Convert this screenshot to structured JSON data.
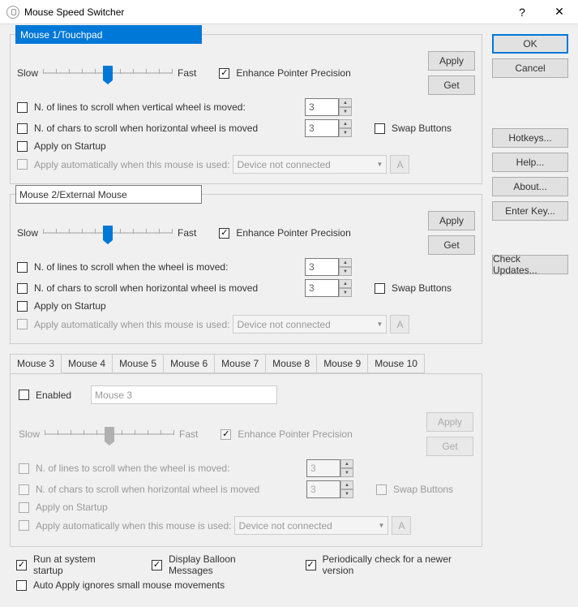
{
  "window": {
    "title": "Mouse Speed Switcher"
  },
  "mouse1": {
    "name": "Mouse 1/Touchpad",
    "slow": "Slow",
    "fast": "Fast",
    "enhance": "Enhance Pointer Precision",
    "lines_label": "N. of lines to scroll when vertical wheel is moved:",
    "lines_value": "3",
    "chars_label": "N. of chars to scroll when  horizontal wheel is moved",
    "chars_value": "3",
    "swap": "Swap Buttons",
    "startup": "Apply on Startup",
    "auto": "Apply automatically when this mouse is used:",
    "device": "Device not connected",
    "apply": "Apply",
    "get": "Get",
    "a": "A"
  },
  "mouse2": {
    "name": "Mouse 2/External Mouse",
    "slow": "Slow",
    "fast": "Fast",
    "enhance": "Enhance Pointer Precision",
    "lines_label": "N. of lines to scroll when the wheel is moved:",
    "lines_value": "3",
    "chars_label": "N. of chars to scroll when  horizontal wheel is moved",
    "chars_value": "3",
    "swap": "Swap Buttons",
    "startup": "Apply on Startup",
    "auto": "Apply automatically when this mouse is used:",
    "device": "Device not connected",
    "apply": "Apply",
    "get": "Get",
    "a": "A"
  },
  "tabs": [
    "Mouse 3",
    "Mouse 4",
    "Mouse 5",
    "Mouse 6",
    "Mouse 7",
    "Mouse 8",
    "Mouse 9",
    "Mouse 10"
  ],
  "mouse3": {
    "enabled": "Enabled",
    "name": "Mouse 3",
    "slow": "Slow",
    "fast": "Fast",
    "enhance": "Enhance Pointer Precision",
    "lines_label": "N. of lines to scroll when the wheel is moved:",
    "lines_value": "3",
    "chars_label": "N. of chars to scroll when  horizontal wheel is moved",
    "chars_value": "3",
    "swap": "Swap Buttons",
    "startup": "Apply on Startup",
    "auto": "Apply automatically when this mouse is used:",
    "device": "Device not connected",
    "apply": "Apply",
    "get": "Get",
    "a": "A"
  },
  "bottom": {
    "run_startup": "Run at system startup",
    "balloon": "Display Balloon Messages",
    "check_version": "Periodically check for a newer version",
    "auto_apply": "Auto Apply ignores small mouse movements"
  },
  "buttons": {
    "ok": "OK",
    "cancel": "Cancel",
    "hotkeys": "Hotkeys...",
    "help": "Help...",
    "about": "About...",
    "enter_key": "Enter Key...",
    "check_updates": "Check Updates..."
  }
}
